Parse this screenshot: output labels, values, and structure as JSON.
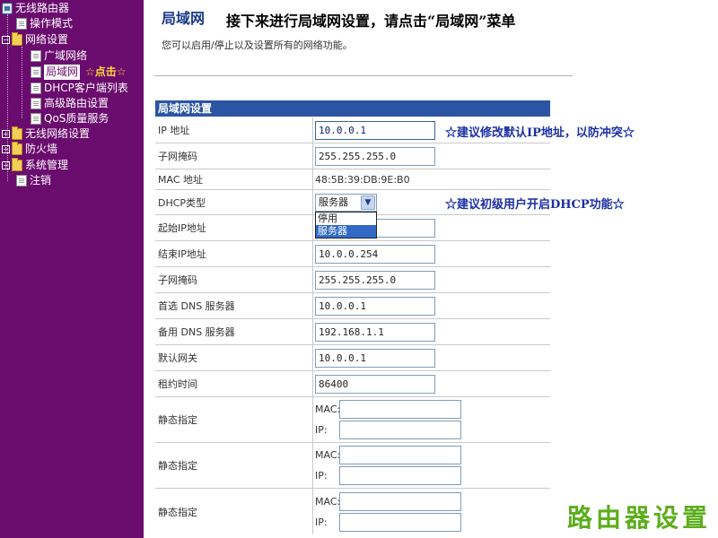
{
  "sidebar": {
    "root": "无线路由器",
    "items": {
      "mode": "操作模式",
      "net": "网络设置",
      "wan": "广域网络",
      "lan": "局域网",
      "dhcp_list": "DHCP客户端列表",
      "routing": "高级路由设置",
      "qos": "QoS质量服务",
      "wireless": "无线网络设置",
      "firewall": "防火墙",
      "system": "系统管理",
      "logout": "注销"
    },
    "click_hint": "☆点击☆"
  },
  "main": {
    "title": "局域网",
    "instruction": "接下来进行局域网设置，请点击“局域网”菜单",
    "subtitle": "您可以启用/停止以及设置所有的网络功能。",
    "table_header": "局域网设置",
    "fields": {
      "ip": {
        "label": "IP 地址",
        "value": "10.0.0.1"
      },
      "mask": {
        "label": "子网掩码",
        "value": "255.255.255.0"
      },
      "mac": {
        "label": "MAC 地址",
        "value": "48:5B:39:DB:9E:B0"
      },
      "dhcp_type": {
        "label": "DHCP类型",
        "value": "服务器"
      },
      "start_ip": {
        "label": "起始IP地址",
        "value": ""
      },
      "end_ip": {
        "label": "结束IP地址",
        "value": "10.0.0.254"
      },
      "mask2": {
        "label": "子网掩码",
        "value": "255.255.255.0"
      },
      "dns1": {
        "label": "首选 DNS 服务器",
        "value": "10.0.0.1"
      },
      "dns2": {
        "label": "备用 DNS 服务器",
        "value": "192.168.1.1"
      },
      "gateway": {
        "label": "默认网关",
        "value": "10.0.0.1"
      },
      "lease": {
        "label": "租约时间",
        "value": "86400"
      }
    },
    "dropdown_options": [
      "停用",
      "服务器"
    ],
    "static": {
      "label": "静态指定",
      "mac_label": "MAC:",
      "ip_label": "IP:"
    }
  },
  "annotations": {
    "ip": "☆建议修改默认IP地址，以防冲突☆",
    "dhcp": "☆建议初级用户开启DHCP功能☆"
  },
  "watermark": "路由器设置",
  "colors": {
    "sidebar_bg": "#6a0b6e",
    "table_header_bg": "#2b55a2",
    "annotation": "#1b2fa5",
    "watermark": "#5cae1c"
  }
}
